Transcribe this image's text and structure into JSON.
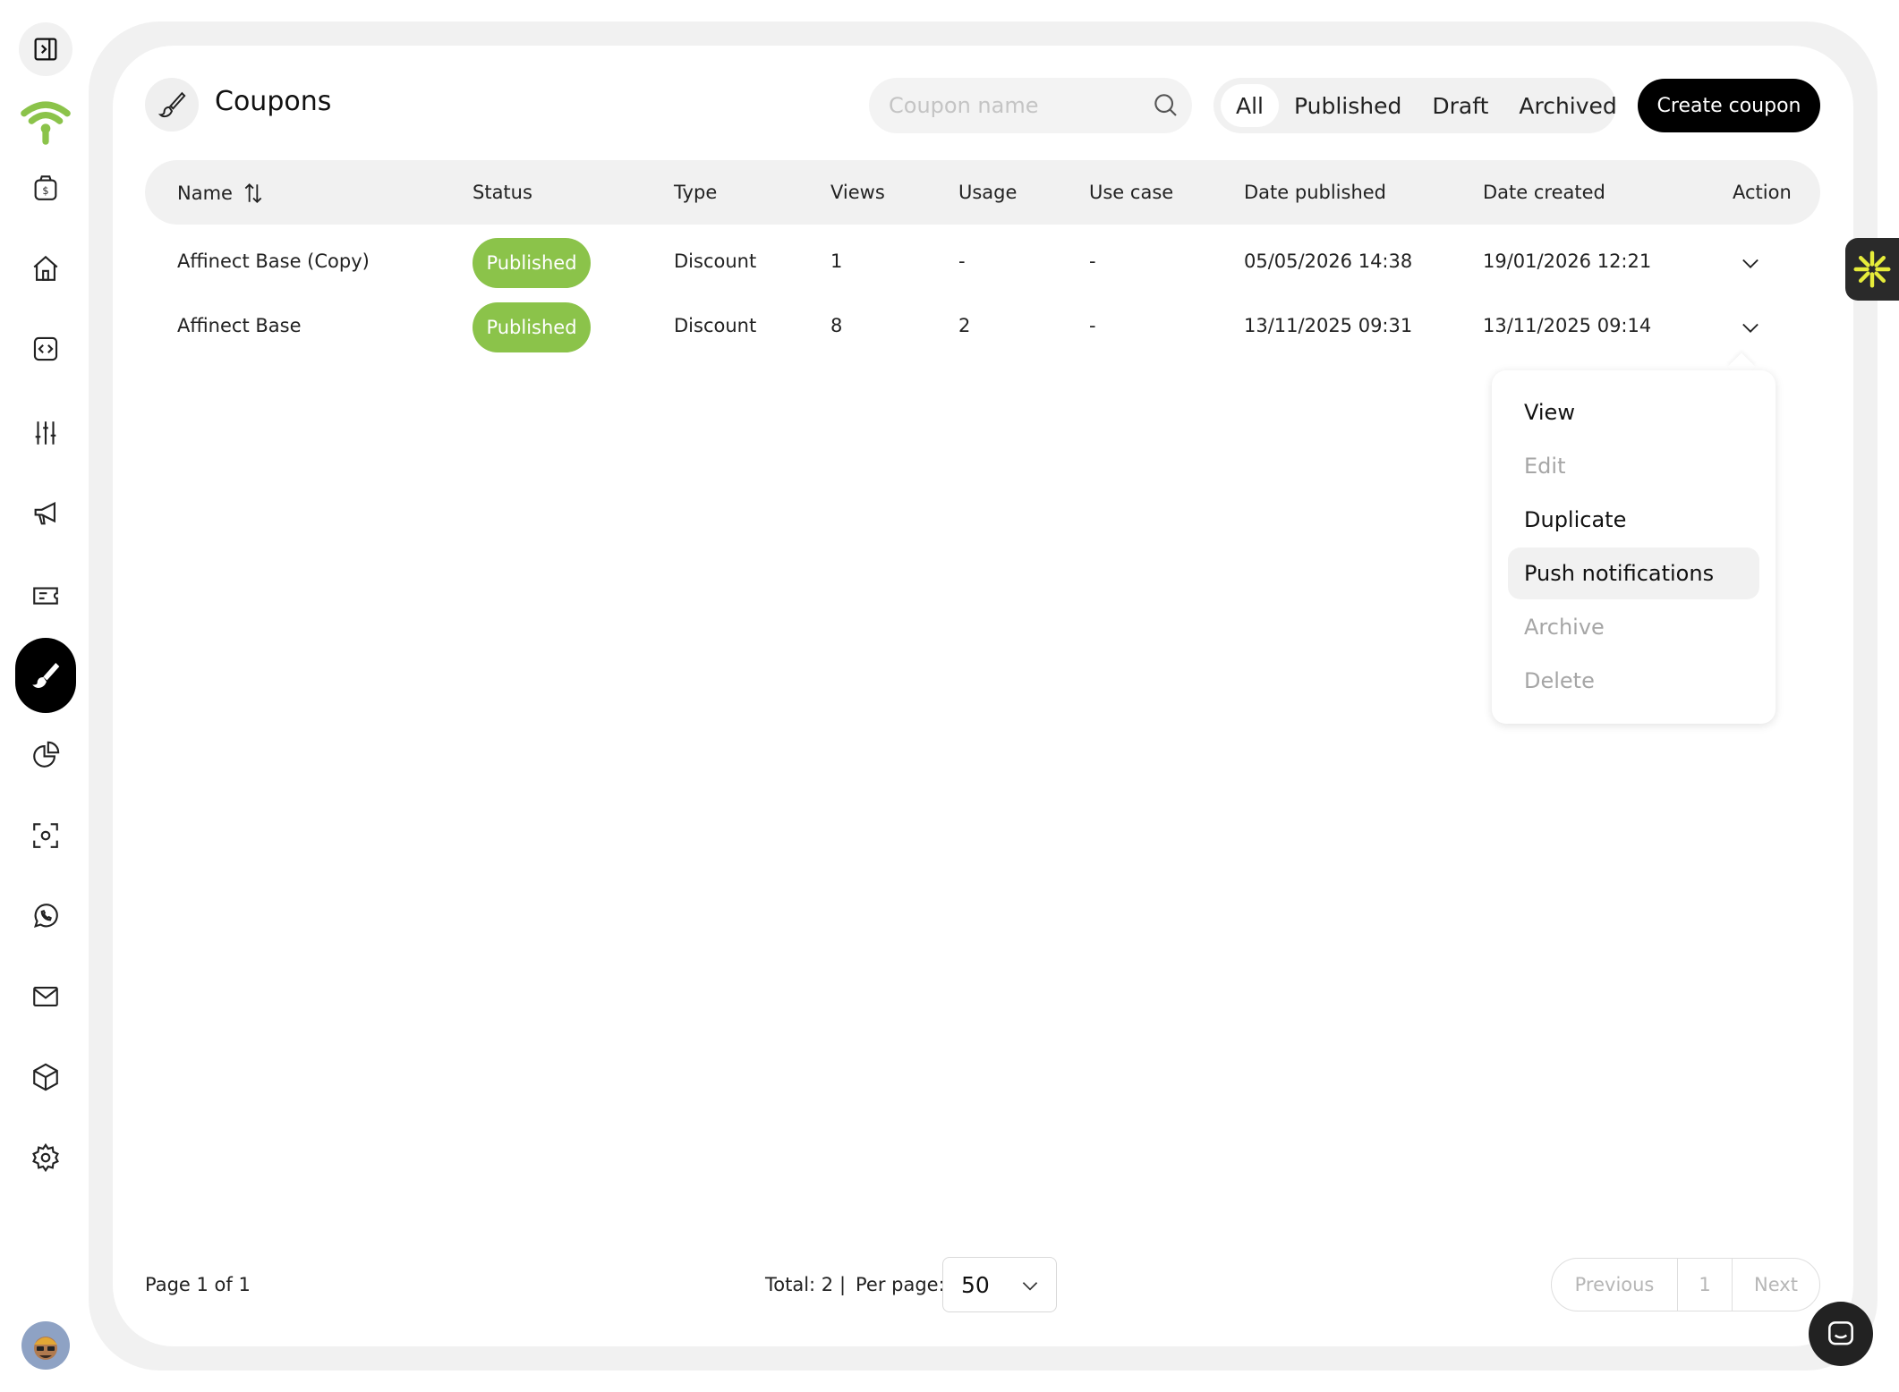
{
  "header": {
    "title": "Coupons",
    "search_placeholder": "Coupon name",
    "filters": [
      "All",
      "Published",
      "Draft",
      "Archived"
    ],
    "active_filter": "All",
    "create_label": "Create coupon"
  },
  "table": {
    "columns": [
      "Name",
      "Status",
      "Type",
      "Views",
      "Usage",
      "Use case",
      "Date published",
      "Date created",
      "Action"
    ],
    "rows": [
      {
        "name": "Affinect Base (Copy)",
        "status": "Published",
        "type": "Discount",
        "views": "1",
        "usage": "-",
        "use_case": "-",
        "date_published": "05/05/2026 14:38",
        "date_created": "19/01/2026 12:21"
      },
      {
        "name": "Affinect Base",
        "status": "Published",
        "type": "Discount",
        "views": "8",
        "usage": "2",
        "use_case": "-",
        "date_published": "13/11/2025 09:31",
        "date_created": "13/11/2025 09:14"
      }
    ]
  },
  "action_menu": {
    "items": [
      "View",
      "Edit",
      "Duplicate",
      "Push notifications",
      "Archive",
      "Delete"
    ],
    "highlighted": "Push notifications",
    "disabled": [
      "Edit",
      "Archive",
      "Delete"
    ]
  },
  "footer": {
    "page_info": "Page 1 of 1",
    "total": "Total: 2",
    "separator": "|",
    "per_page_label": "Per page:",
    "per_page_value": "50",
    "prev_label": "Previous",
    "current_page": "1",
    "next_label": "Next"
  },
  "colors": {
    "accent_green": "#8bc34a",
    "dark": "#000000",
    "surface": "#f1f1f1"
  },
  "sidebar_icons": [
    "sidebar-toggle-icon",
    "wifi-logo-icon",
    "money-bag-icon",
    "home-icon",
    "code-icon",
    "sliders-icon",
    "megaphone-icon",
    "ticket-icon",
    "brush-icon",
    "pie-chart-icon",
    "scan-icon",
    "whatsapp-icon",
    "mail-icon",
    "box-icon",
    "gear-icon"
  ]
}
